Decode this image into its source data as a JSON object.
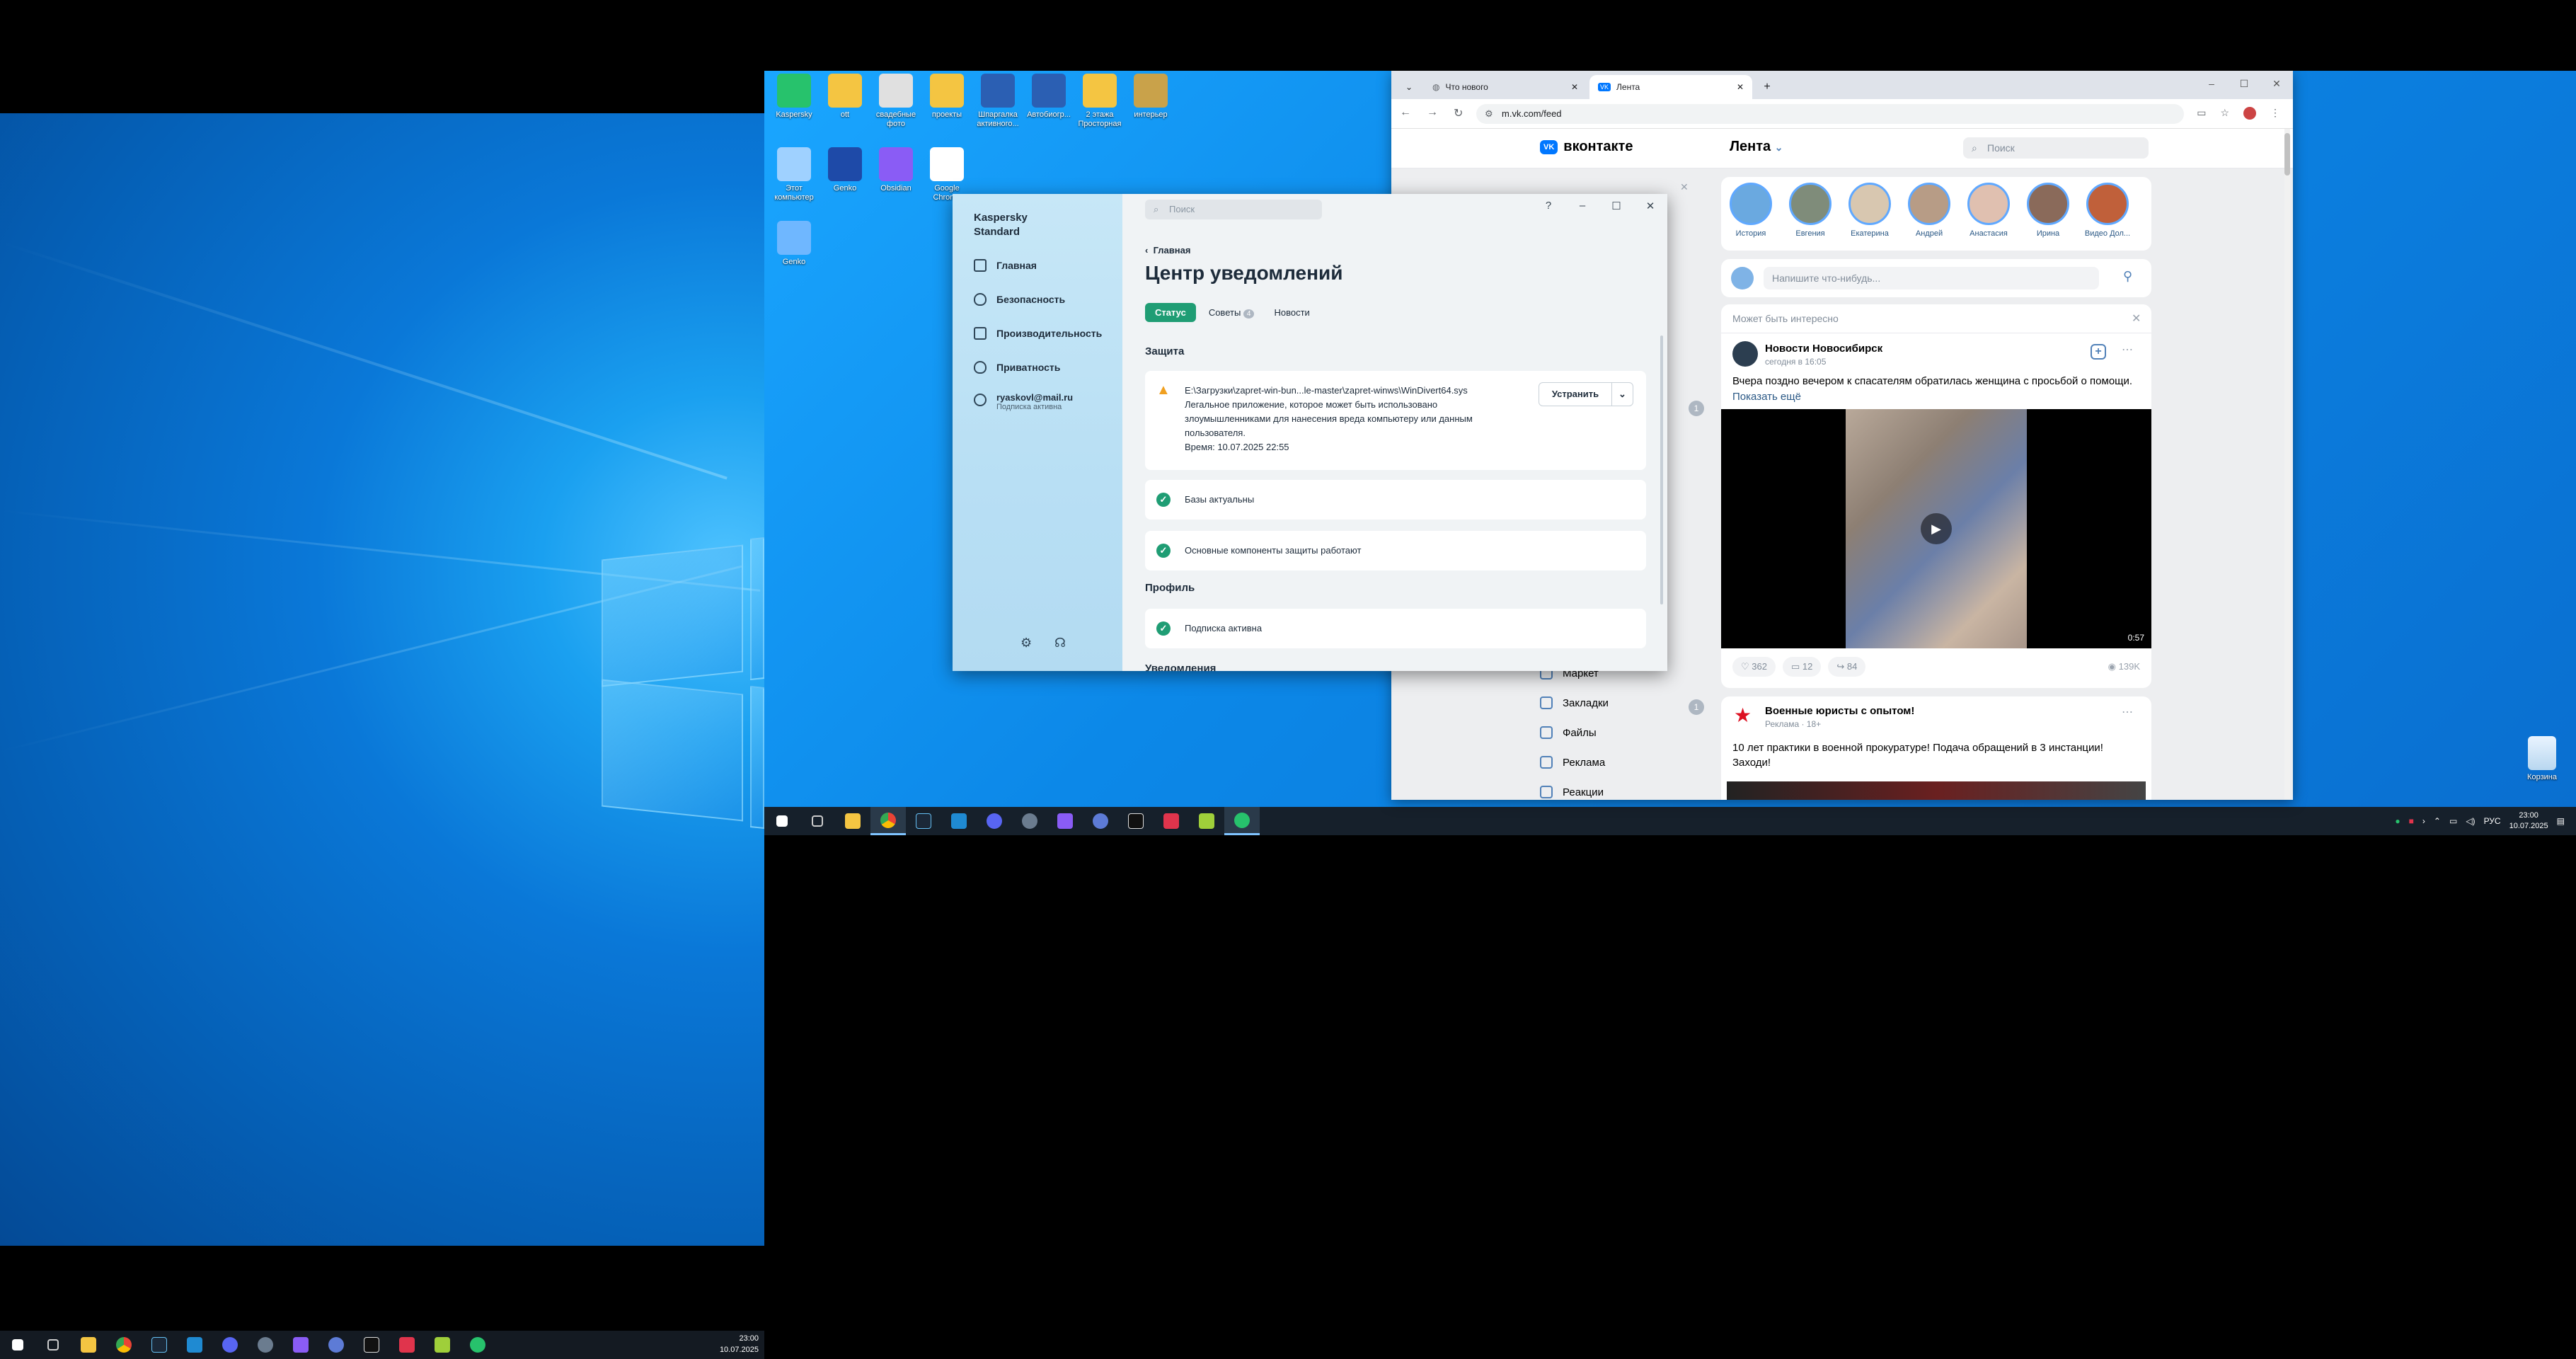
{
  "left_taskbar": {
    "clock_time": "23:00",
    "clock_date": "10.07.2025"
  },
  "desktop_icons": [
    {
      "label": "Kaspersky",
      "icon": "kaspersky-icon",
      "color": "#27c26c"
    },
    {
      "label": "ott",
      "icon": "folder-icon",
      "color": "#f4c542"
    },
    {
      "label": "свадебные фото",
      "icon": "drive-icon",
      "color": "#e0e0e0"
    },
    {
      "label": "проекты",
      "icon": "folder-icon",
      "color": "#f4c542"
    },
    {
      "label": "Шпаргалка активного...",
      "icon": "word-icon",
      "color": "#2b5fb3"
    },
    {
      "label": "Автобиогр...",
      "icon": "word-icon",
      "color": "#2b5fb3"
    },
    {
      "label": "2 этажа Просторная",
      "icon": "folder-icon",
      "color": "#f4c542"
    },
    {
      "label": "интерьер",
      "icon": "archive-icon",
      "color": "#c9a24a"
    },
    {
      "label": "Этот компьютер",
      "icon": "computer-icon",
      "color": "#9fd1ff"
    },
    {
      "label": "Genko",
      "icon": "alien-icon",
      "color": "#1e4aa8"
    },
    {
      "label": "Obsidian",
      "icon": "obsidian-icon",
      "color": "#8a5cf5"
    },
    {
      "label": "Google Chrome",
      "icon": "chrome-icon",
      "color": "#ffffff"
    },
    {
      "label": "Genko",
      "icon": "shortcut-icon",
      "color": "#6fb7ff"
    }
  ],
  "recycle_bin": {
    "label": "Корзина"
  },
  "right_taskbar": {
    "lang": "РУС",
    "clock_time": "23:00",
    "clock_date": "10.07.2025"
  },
  "kaspersky": {
    "app_name_line1": "Kaspersky",
    "app_name_line2": "Standard",
    "search_placeholder": "Поиск",
    "nav": [
      {
        "label": "Главная",
        "icon": "home-grid-icon"
      },
      {
        "label": "Безопасность",
        "icon": "shield-icon"
      },
      {
        "label": "Производительность",
        "icon": "performance-icon"
      },
      {
        "label": "Приватность",
        "icon": "privacy-shield-icon"
      }
    ],
    "account_email": "ryaskovl@mail.ru",
    "account_status": "Подписка активна",
    "back_label": "Главная",
    "page_title": "Центр уведомлений",
    "tabs": [
      {
        "label": "Статус",
        "active": true
      },
      {
        "label": "Советы",
        "badge": "4"
      },
      {
        "label": "Новости"
      }
    ],
    "section_protection": "Защита",
    "warning": {
      "path": "E:\\Загрузки\\zapret-win-bun...le-master\\zapret-winws\\WinDivert64.sys",
      "description": "Легальное приложение, которое может быть использовано злоумышленниками для нанесения вреда компьютеру или данным пользователя.",
      "time": "Время: 10.07.2025 22:55",
      "action": "Устранить"
    },
    "ok_items": [
      "Базы актуальны",
      "Основные компоненты защиты работают"
    ],
    "section_profile": "Профиль",
    "profile_items": [
      "Подписка активна"
    ],
    "section_next": "Уведомления"
  },
  "browser": {
    "tab1": "Что нового",
    "tab2": "Лента",
    "url": "m.vk.com/feed"
  },
  "vk": {
    "logo": "вконтакте",
    "feed_title": "Лента",
    "search_placeholder": "Поиск",
    "stories": [
      "История",
      "Евгения",
      "Екатерина",
      "Андрей",
      "Анастасия",
      "Ирина",
      "Видео Дол..."
    ],
    "compose_placeholder": "Напишите что-нибудь...",
    "interesting": "Может быть интересно",
    "post1": {
      "author": "Новости Новосибирск",
      "time": "сегодня в 16:05",
      "text": "Вчера поздно вечером к спасателям обратилась женщина с просьбой о помощи.",
      "more": "Показать ещё",
      "duration": "0:57",
      "likes": "362",
      "comments": "12",
      "shares": "84",
      "views": "139K"
    },
    "post2": {
      "author": "Военные юристы с опытом!",
      "meta": "Реклама · 18+",
      "text": "10 лет практики в военной прокуратуре! Подача обращений в 3 инстанции! Заходи!"
    },
    "menu": [
      "Маркет",
      "Закладки",
      "Файлы",
      "Реклама",
      "Реакции"
    ],
    "badges": [
      "1",
      "1"
    ]
  }
}
